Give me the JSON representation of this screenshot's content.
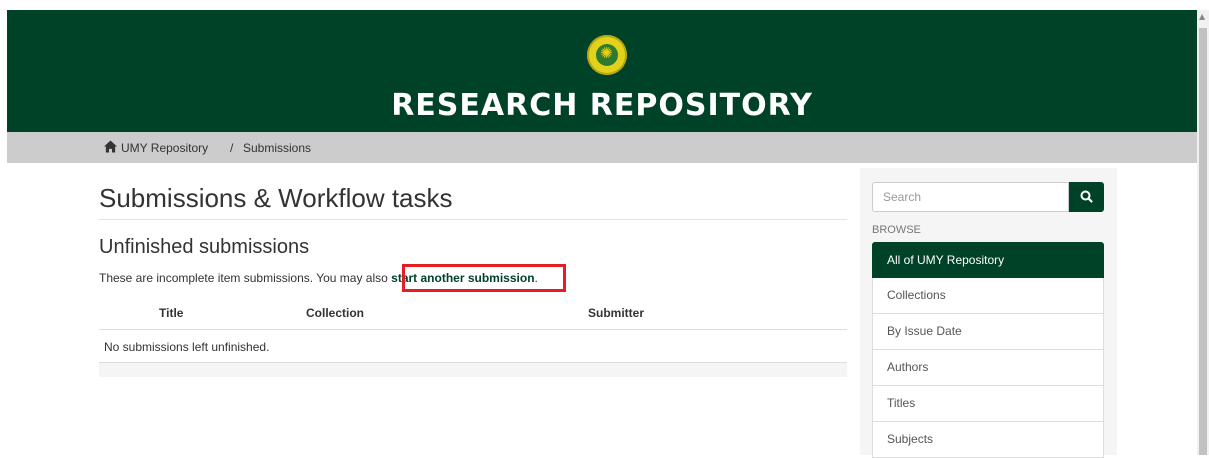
{
  "header": {
    "repo_title": "RESEARCH REPOSITORY",
    "brand_color": "#004228",
    "logo": "university-seal-logo"
  },
  "breadcrumb": {
    "home_icon": "home-icon",
    "items": [
      "UMY Repository",
      "/",
      "Submissions"
    ]
  },
  "main": {
    "page_title": "Submissions & Workflow tasks",
    "section_title": "Unfinished submissions",
    "intro_text": "These are incomplete item submissions. You may also ",
    "start_link": "start another submission",
    "intro_end": ".",
    "highlight_color": "#e31e24",
    "table": {
      "headers": [
        "Title",
        "Collection",
        "Submitter"
      ],
      "empty_message": "No submissions left unfinished."
    }
  },
  "sidebar": {
    "search_placeholder": "Search",
    "search_icon": "search-icon",
    "browse_label": "BROWSE",
    "items": [
      {
        "label": "All of UMY Repository",
        "active": true
      },
      {
        "label": "Collections"
      },
      {
        "label": "By Issue Date"
      },
      {
        "label": "Authors"
      },
      {
        "label": "Titles"
      },
      {
        "label": "Subjects"
      }
    ]
  }
}
